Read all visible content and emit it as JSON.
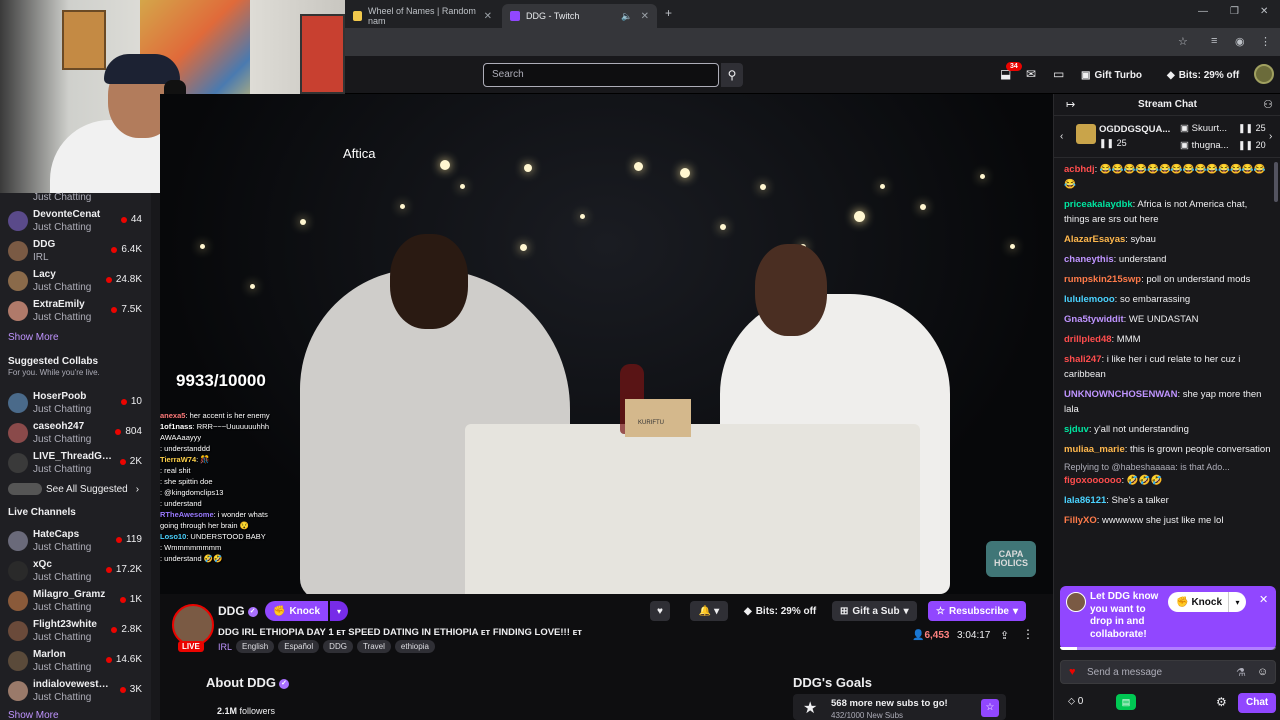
{
  "browser": {
    "tabs": [
      {
        "label": "Wheel of Names | Random nam",
        "active": false
      },
      {
        "label": "DDG - Twitch",
        "active": true
      }
    ],
    "new_tab": "+"
  },
  "topnav": {
    "search_placeholder": "Search",
    "notif_count": "34",
    "gift_turbo": "Gift Turbo",
    "bits": "Bits: 29% off"
  },
  "webcam": {
    "caption": "Aftica"
  },
  "sidebar": {
    "top_partial": "Just Chatting",
    "followed": [
      {
        "name": "DevonteCenat",
        "category": "Just Chatting",
        "viewers": "44",
        "color": "#5a4a8a"
      },
      {
        "name": "DDG",
        "category": "IRL",
        "viewers": "6.4K",
        "color": "#7a5a44"
      },
      {
        "name": "Lacy",
        "category": "Just Chatting",
        "viewers": "24.8K",
        "color": "#8a6a4a"
      },
      {
        "name": "ExtraEmily",
        "category": "Just Chatting",
        "viewers": "7.5K",
        "color": "#b07a6a"
      }
    ],
    "show_more": "Show More",
    "suggested_title": "Suggested Collabs",
    "suggested_sub": "For you. While you're live.",
    "suggested": [
      {
        "name": "HoserPoob",
        "category": "Just Chatting",
        "viewers": "10",
        "color": "#4a6a8a"
      },
      {
        "name": "caseoh247",
        "category": "Just Chatting",
        "viewers": "804",
        "color": "#8a4a4a"
      },
      {
        "name": "LIVE_ThreadGu...",
        "category": "Just Chatting",
        "viewers": "2K",
        "color": "#3a3a3a"
      }
    ],
    "see_all": "See All Suggested",
    "live_title": "Live Channels",
    "live": [
      {
        "name": "HateCaps",
        "category": "Just Chatting",
        "viewers": "119",
        "color": "#6a6a7a"
      },
      {
        "name": "xQc",
        "category": "Just Chatting",
        "viewers": "17.2K",
        "color": "#2a2a2a"
      },
      {
        "name": "Milagro_Gramz",
        "category": "Just Chatting",
        "viewers": "1K",
        "color": "#8a5a3a"
      },
      {
        "name": "Flight23white",
        "category": "Just Chatting",
        "viewers": "2.8K",
        "color": "#6a4a3a"
      },
      {
        "name": "Marlon",
        "category": "Just Chatting",
        "viewers": "14.6K",
        "color": "#5a4a3a"
      },
      {
        "name": "indialovewestbr...",
        "category": "Just Chatting",
        "viewers": "3K",
        "color": "#9a7a6a"
      }
    ],
    "show_more_bottom": "Show More"
  },
  "video": {
    "counter": "9933/10000",
    "watermark_top": "CAPA",
    "watermark_bottom": "HOLICS",
    "box_label": "KURIFTU",
    "overlay_chat": [
      {
        "user": "anexa5",
        "text": ": her accent is her enemy",
        "color": "#ff7b7b"
      },
      {
        "user": "1of1nass",
        "text": ": RRR~~~Uuuuuuuhhh",
        "color": "#ffffff"
      },
      {
        "user": "",
        "text": "AWAAaayyy",
        "color": "#ffffff"
      },
      {
        "user": "",
        "text": ": understanddd",
        "color": "#ff4d4d"
      },
      {
        "user": "TierraW74",
        "text": ": 🎊",
        "color": "#ffd24a"
      },
      {
        "user": "",
        "text": ": real shit",
        "color": "#4a7aff"
      },
      {
        "user": "",
        "text": ": she spittin doe",
        "color": "#ff7b4a"
      },
      {
        "user": "",
        "text": ": @kingdomclips13",
        "color": "#4a4aff"
      },
      {
        "user": "",
        "text": ": understand",
        "color": "#ff4d4d"
      },
      {
        "user": "RTheAwesome",
        "text": ": i wonder whats",
        "color": "#9a7aff"
      },
      {
        "user": "",
        "text": "going through her brain 😯",
        "color": "#ffffff"
      },
      {
        "user": "Loso10",
        "text": ": UNDERSTOOD BABY",
        "color": "#4ad2ff"
      },
      {
        "user": "",
        "text": ": Wmmmmmmmm",
        "color": "#ff4dff"
      },
      {
        "user": "",
        "text": ": understand 🤣🤣",
        "color": "#ff7b4a"
      }
    ]
  },
  "channel": {
    "name": "DDG",
    "knock": "Knock",
    "live": "LIVE",
    "title": "DDG IRL ETHIOPIA DAY 1 ᴇᴛ SPEED DATING IN ETHIOPIA ᴇᴛ FINDING LOVE!!! ᴇᴛ",
    "category": "IRL",
    "tags": [
      "English",
      "Español",
      "DDG",
      "Travel",
      "ethiopia"
    ],
    "bits": "Bits: 29% off",
    "gift_sub": "Gift a Sub",
    "resubscribe": "Resubscribe",
    "viewers": "6,453",
    "uptime": "3:04:17",
    "about": "About DDG",
    "followers_count": "2.1M",
    "followers_label": "followers",
    "goals_title": "DDG's Goals",
    "goal_text": "568 more new subs to go!",
    "goal_sub": "432/1000 New Subs"
  },
  "chat": {
    "title": "Stream Chat",
    "gifters": [
      {
        "name": "OGDDGSQUA...",
        "count": "25"
      },
      {
        "name": "Skuurt...",
        "count": "25"
      },
      {
        "name": "thugna...",
        "count": "20"
      }
    ],
    "messages": [
      {
        "user": "acbhdj",
        "text": ": 😂😂😂😂😂😂😂😂😂😂😂😂😂😂😂",
        "color": "#ff4d4d"
      },
      {
        "user": "priceakalaydbk",
        "text": ": Africa is not America chat, things are srs out here",
        "color": "#00e5a0"
      },
      {
        "user": "AlazarEsayas",
        "text": ": sybau",
        "color": "#ffb84d"
      },
      {
        "user": "chaneythis",
        "text": ": understand",
        "color": "#bf94ff"
      },
      {
        "user": "rumpskin215swp",
        "text": ": poll on understand mods",
        "color": "#ff7b4a"
      },
      {
        "user": "lululemooo",
        "text": ": so embarrassing",
        "color": "#4ad2ff"
      },
      {
        "user": "Gna5tywiddit",
        "text": ": WE UNDASTAN",
        "color": "#bf94ff"
      },
      {
        "user": "drillpled48",
        "text": ": MMM",
        "color": "#ff4d4d"
      },
      {
        "user": "shali247",
        "text": ": i like her i cud relate to her cuz i caribbean",
        "color": "#ff4d4d"
      },
      {
        "user": "UNKNOWNCHOSENWAN",
        "text": ": she yap more then lala",
        "color": "#bf94ff"
      },
      {
        "user": "sjduv",
        "text": ": y'all not understanding",
        "color": "#00e5a0"
      },
      {
        "user": "muliaa_marie",
        "text": ": this is grown people conversation",
        "color": "#ffb84d"
      },
      {
        "reply": "Replying to @habeshaaaaa: is that Ado..."
      },
      {
        "user": "figoxoooooo",
        "text": ": 🤣🤣🤣",
        "color": "#ff4d4d"
      },
      {
        "user": "lala86121",
        "text": ": She's a talker",
        "color": "#4ad2ff"
      },
      {
        "user": "FillyXO",
        "text": ": wwwwww she just like me lol",
        "color": "#ff7b4a"
      }
    ],
    "knock_card": "Let DDG know you want to drop in and collaborate!",
    "knock_btn": "Knock",
    "knock_progress": 0.08,
    "send_placeholder": "Send a message",
    "points": "0",
    "chat_btn": "Chat"
  }
}
